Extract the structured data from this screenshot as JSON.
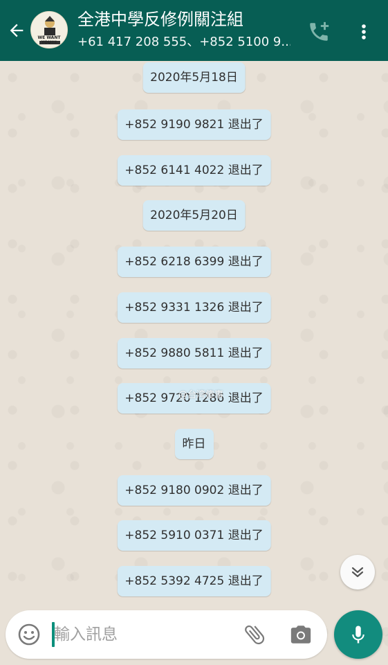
{
  "header": {
    "title": "全港中學反修例關注組",
    "subtitle": "+61 417 208 555、+852 5100 9...",
    "avatar_text": "WE WANT YOU!!!"
  },
  "messages": [
    "2020年5月18日",
    "+852 9190 9821 退出了",
    "+852 6141 4022 退出了",
    "2020年5月20日",
    "+852 6218 6399 退出了",
    "+852 9331 1326 退出了",
    "+852 9880 5811 退出了",
    "+852 9720 1286 退出了",
    "昨日",
    "+852 9180 0902 退出了",
    "+852 5910 0371 退出了",
    "+852 5392 4725 退出了"
  ],
  "watermark": "@台湾傻事",
  "composer": {
    "placeholder": "輸入訊息"
  },
  "icons": {
    "back": "arrow-left-icon",
    "call_add": "phone-plus-icon",
    "menu": "more-vert-icon",
    "scroll_down": "double-chevron-down-icon",
    "emoji": "emoji-icon",
    "attach": "paperclip-icon",
    "camera": "camera-icon",
    "mic": "microphone-icon"
  },
  "colors": {
    "header": "#075e54",
    "bubble": "#d4eaf4",
    "mic_button": "#128c7e"
  }
}
